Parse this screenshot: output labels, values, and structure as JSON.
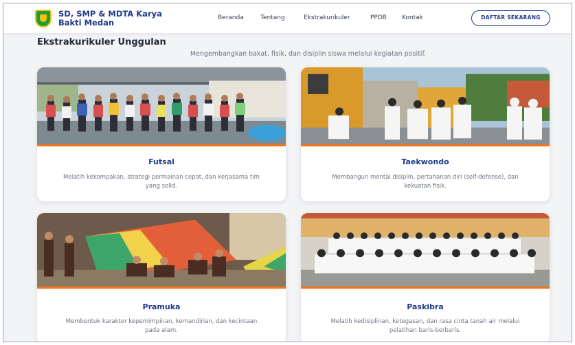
{
  "header": {
    "brand": "SD, SMP & MDTA Karya Bakti Medan",
    "menu": [
      "Beranda",
      "Tentang",
      "Ekstrakurikuler",
      "PPDB",
      "Kontak"
    ],
    "cta": "DAFTAR SEKARANG"
  },
  "section": {
    "title": "Ekstrakurikuler Unggulan",
    "subtitle": "Mengembangkan bakat, fisik, dan disiplin siswa melalui kegiatan positif."
  },
  "cards": [
    {
      "title": "Futsal",
      "description": "Melatih kekompakan, strategi permainan cepat, dan kerjasama tim yang solid."
    },
    {
      "title": "Taekwondo",
      "description": "Membangun mental disiplin, pertahanan diri (self-defense), dan kekuatan fisik."
    },
    {
      "title": "Pramuka",
      "description": "Membentuk karakter kepemimpinan, kemandirian, dan kecintaan pada alam."
    },
    {
      "title": "Paskibra",
      "description": "Melatih kedisiplinan, ketegasan, dan rasa cinta tanah air melalui pelatihan baris-berbaris."
    }
  ],
  "colors": {
    "brand_blue": "#1e3a8a",
    "accent_orange": "#f97316",
    "logo_green": "#1f9d3a",
    "logo_yellow": "#f4c20d"
  }
}
